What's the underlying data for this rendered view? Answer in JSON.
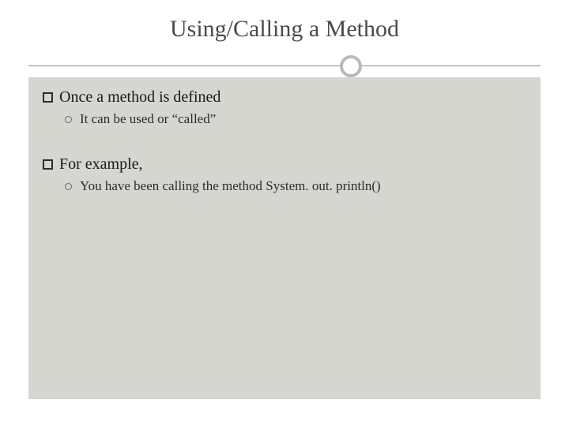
{
  "title": "Using/Calling a Method",
  "bullets": [
    {
      "level": 1,
      "text": "Once a method is defined"
    },
    {
      "level": 2,
      "text": "It can be used or “called”"
    },
    {
      "level": 1,
      "text": "For example,"
    },
    {
      "level": 2,
      "text": "You have been calling the method System. out. println()"
    }
  ]
}
